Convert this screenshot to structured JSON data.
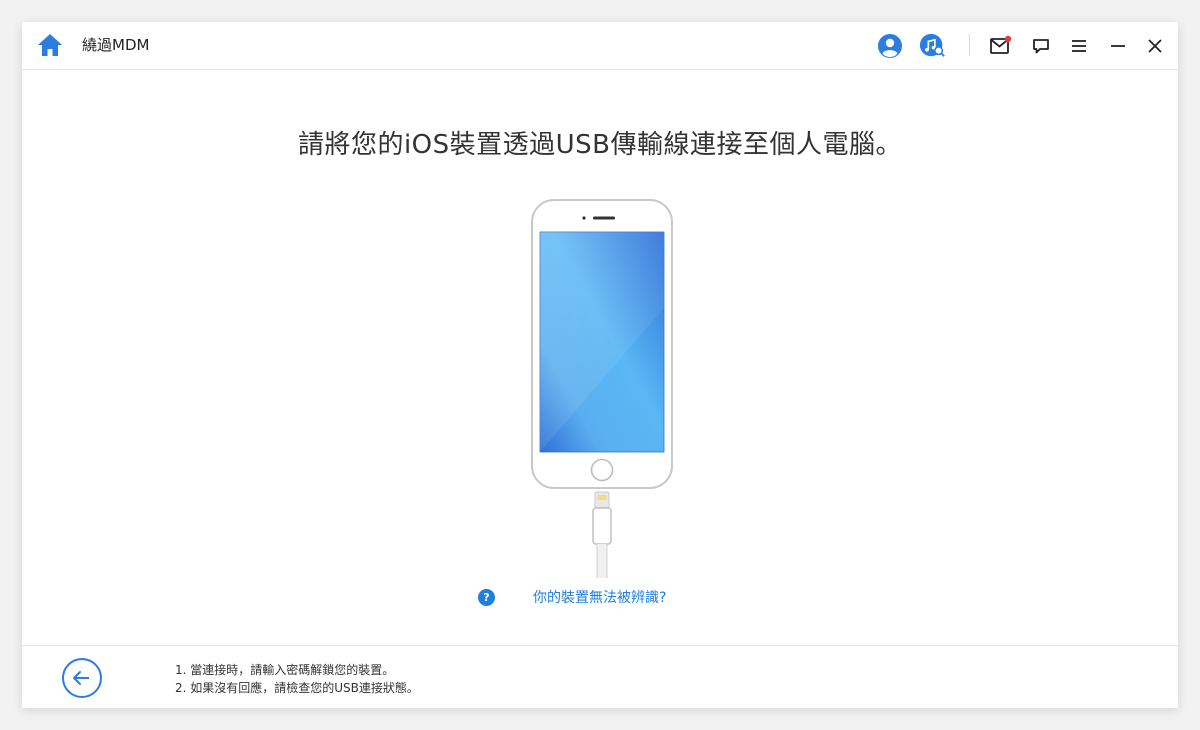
{
  "app": {
    "title": "繞過MDM"
  },
  "titlebar": {
    "icons": [
      "home-icon",
      "account-icon",
      "music-search-icon",
      "mail-icon",
      "feedback-icon",
      "menu-icon",
      "minimize-icon",
      "close-icon"
    ],
    "mail_has_notification": true
  },
  "main": {
    "headline": "請將您的iOS裝置透過USB傳輸線連接至個人電腦。",
    "help_icon_text": "?",
    "help_link": "你的裝置無法被辨識?"
  },
  "footer": {
    "tip1": "1. 當連接時，請輸入密碼解鎖您的裝置。",
    "tip2": "2. 如果沒有回應，請檢查您的USB連接狀態。"
  },
  "colors": {
    "accent": "#1f7fe0",
    "home": "#2a7de1",
    "notification": "#e53935"
  }
}
